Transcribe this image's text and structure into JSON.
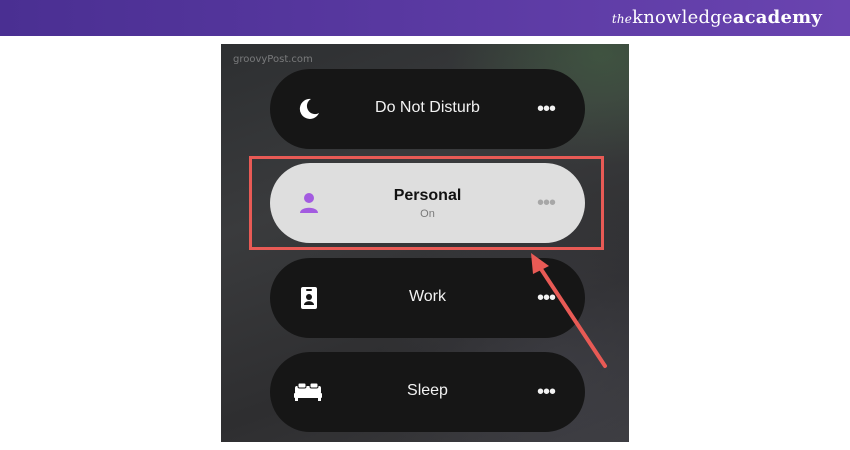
{
  "brand": {
    "the": "the",
    "knowledge": "knowledge",
    "academy": "academy"
  },
  "screenshot": {
    "watermark": "groovyPost.com",
    "focus_modes": [
      {
        "label": "Do Not Disturb",
        "icon": "moon-icon",
        "status": "",
        "active": false
      },
      {
        "label": "Personal",
        "icon": "person-icon",
        "status": "On",
        "active": true
      },
      {
        "label": "Work",
        "icon": "id-badge-icon",
        "status": "",
        "active": false
      },
      {
        "label": "Sleep",
        "icon": "bed-icon",
        "status": "",
        "active": false
      }
    ],
    "more_glyph": "•••"
  },
  "colors": {
    "banner": "#5b3aa3",
    "highlight": "#e85a55",
    "personal_icon": "#a35be0",
    "pill_dark": "#161616",
    "pill_active": "#dedede"
  }
}
